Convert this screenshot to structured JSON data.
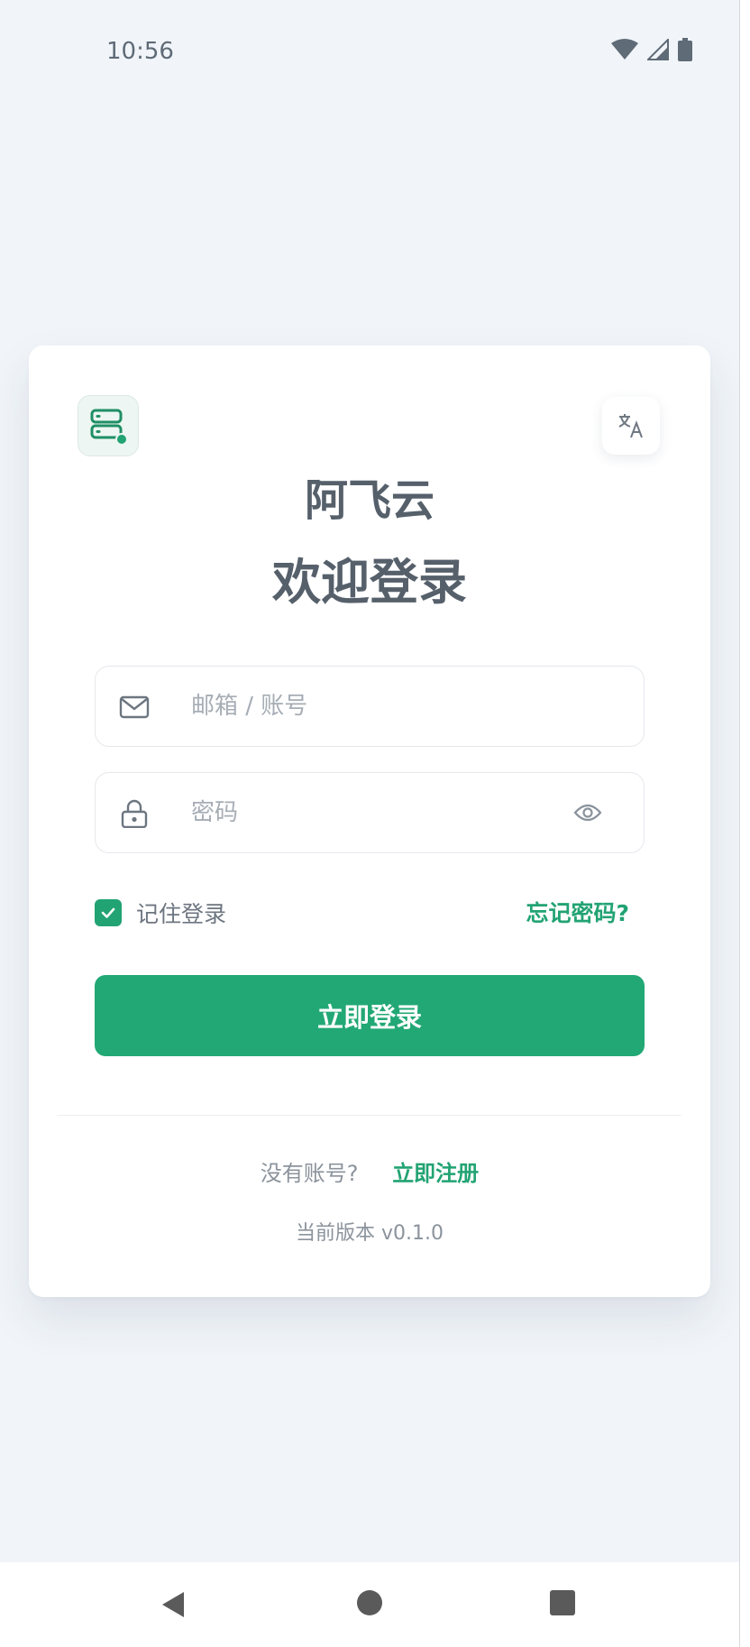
{
  "status_bar": {
    "time": "10:56",
    "icons": [
      "wifi-icon",
      "cellular-signal-icon",
      "battery-icon"
    ]
  },
  "login": {
    "logo_icon": "server-icon",
    "language_icon": "translate-icon",
    "app_name": "阿飞云",
    "welcome": "欢迎登录",
    "email": {
      "placeholder": "邮箱 / 账号",
      "value": "",
      "icon": "mail-icon"
    },
    "password": {
      "placeholder": "密码",
      "value": "",
      "icon": "lock-icon",
      "toggle_icon": "eye-icon"
    },
    "remember": {
      "label": "记住登录",
      "checked": true
    },
    "forgot_label": "忘记密码?",
    "submit_label": "立即登录",
    "no_account_text": "没有账号?",
    "register_label": "立即注册",
    "version_text": "当前版本 v0.1.0"
  },
  "nav_bar": {
    "icons": [
      "back-icon",
      "home-icon",
      "recents-icon"
    ]
  },
  "colors": {
    "accent": "#22a373",
    "background": "#f1f5f9",
    "card": "#ffffff",
    "title_text": "#56606b"
  }
}
